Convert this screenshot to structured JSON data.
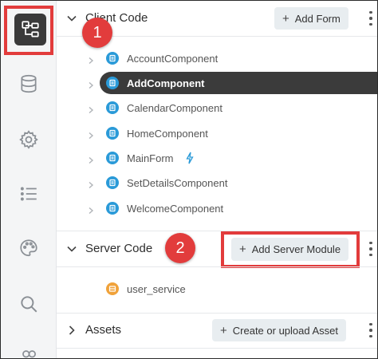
{
  "sections": {
    "client_code": {
      "title": "Client Code",
      "add_button": "Add Form",
      "items": [
        {
          "label": "AccountComponent",
          "selected": false
        },
        {
          "label": "AddComponent",
          "selected": true
        },
        {
          "label": "CalendarComponent",
          "selected": false
        },
        {
          "label": "HomeComponent",
          "selected": false
        },
        {
          "label": "MainForm",
          "selected": false,
          "startup_icon": "lightning-icon"
        },
        {
          "label": "SetDetailsComponent",
          "selected": false
        },
        {
          "label": "WelcomeComponent",
          "selected": false
        }
      ]
    },
    "server_code": {
      "title": "Server Code",
      "add_button": "Add Server Module",
      "items": [
        {
          "label": "user_service"
        }
      ]
    },
    "assets": {
      "title": "Assets",
      "add_button": "Create or upload Asset"
    }
  },
  "rail": {
    "icons": [
      "app-browser-icon",
      "database-icon",
      "settings-icon",
      "list-icon",
      "palette-icon",
      "search-icon",
      "users-icon"
    ],
    "active": "app-browser-icon"
  },
  "callouts": {
    "one": "1",
    "two": "2"
  },
  "colors": {
    "highlight": "#e23c3c",
    "selected_bg": "#3b3b3b",
    "form_icon": "#2a9ad8",
    "module_icon": "#f0a23a",
    "button_bg": "#e8edf0"
  }
}
